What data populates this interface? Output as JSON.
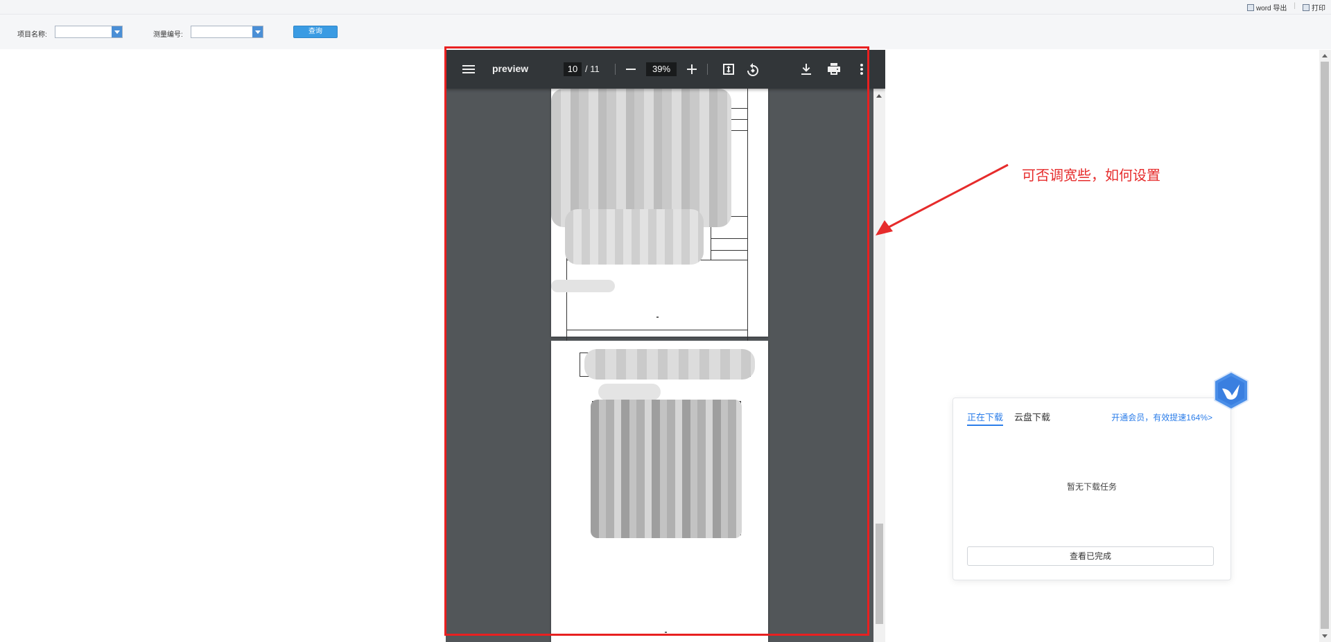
{
  "topbar": {
    "word_export": "word 导出",
    "separator": "|",
    "print": "打印"
  },
  "filters": {
    "project_name_label": "项目名称:",
    "project_name_value": "",
    "survey_no_label": "测量编号:",
    "survey_no_value": "",
    "query_button": "查询"
  },
  "viewer": {
    "title": "preview",
    "current_page": "10",
    "total_pages": "/ 11",
    "zoom": "39%"
  },
  "annotation": {
    "text": "可否调宽些，如何设置",
    "color": "#e62b2b"
  },
  "download_panel": {
    "tab_active": "正在下载",
    "tab_cloud": "云盘下载",
    "promo": "开通会员，有效提速164%>",
    "empty_text": "暂无下载任务",
    "view_completed": "查看已完成"
  },
  "colors": {
    "accent_blue": "#2b7de9",
    "highlight_red": "#e82020",
    "viewer_bg": "#525659",
    "viewer_toolbar": "#323639"
  }
}
